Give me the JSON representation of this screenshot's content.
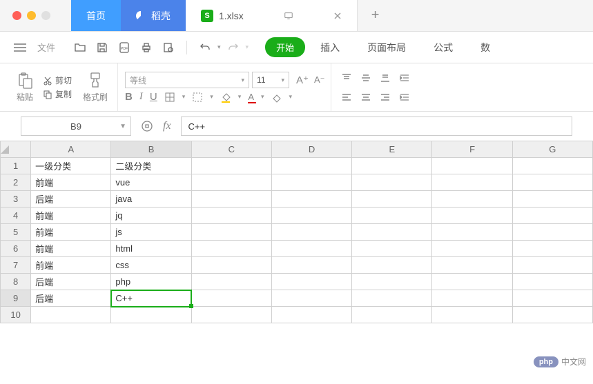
{
  "window": {
    "home_tab": "首页",
    "daoke_tab": "稻壳",
    "file_tab": "1.xlsx",
    "plus": "+"
  },
  "toolbar": {
    "file_label": "文件",
    "start": "开始",
    "insert": "插入",
    "layout": "页面布局",
    "formula": "公式",
    "data": "数"
  },
  "ribbon": {
    "paste": "粘贴",
    "cut": "剪切",
    "copy": "复制",
    "format_painter": "格式刷",
    "font_name": "等线",
    "font_size": "11",
    "bold": "B",
    "italic": "I",
    "underline": "U"
  },
  "formula_bar": {
    "namebox": "B9",
    "fx": "fx",
    "value": "C++"
  },
  "columns": [
    "A",
    "B",
    "C",
    "D",
    "E",
    "F",
    "G"
  ],
  "rows": [
    {
      "n": "1",
      "A": "一级分类",
      "B": "二级分类"
    },
    {
      "n": "2",
      "A": "前端",
      "B": "vue"
    },
    {
      "n": "3",
      "A": "后端",
      "B": "java"
    },
    {
      "n": "4",
      "A": "前端",
      "B": "jq"
    },
    {
      "n": "5",
      "A": "前端",
      "B": "js"
    },
    {
      "n": "6",
      "A": "前端",
      "B": "html"
    },
    {
      "n": "7",
      "A": "前端",
      "B": "css"
    },
    {
      "n": "8",
      "A": "后端",
      "B": "php"
    },
    {
      "n": "9",
      "A": "后端",
      "B": "C++"
    },
    {
      "n": "10",
      "A": "",
      "B": ""
    }
  ],
  "watermark": {
    "php": "php",
    "text": "中文网"
  }
}
